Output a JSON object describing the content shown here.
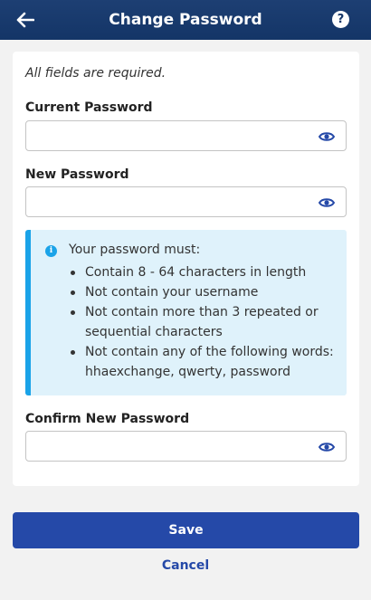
{
  "header": {
    "title": "Change Password",
    "back_icon": "arrow-left-icon",
    "help_label": "?",
    "background_color": "#143567"
  },
  "form": {
    "required_note": "All fields are required.",
    "current_password": {
      "label": "Current Password",
      "value": "",
      "placeholder": ""
    },
    "new_password": {
      "label": "New Password",
      "value": "",
      "placeholder": ""
    },
    "confirm_password": {
      "label": "Confirm New Password",
      "value": "",
      "placeholder": ""
    },
    "visibility_icon": "eye-icon"
  },
  "rules": {
    "icon": "info-icon",
    "icon_glyph": "i",
    "intro": "Your password must:",
    "items": [
      "Contain 8 - 64 characters in length",
      "Not contain your username",
      "Not contain more than 3 repeated or sequential characters",
      "Not contain any of the following words: hhaexchange, qwerty, password"
    ],
    "accent_color": "#1aa3e8",
    "background_color": "#dff2fb"
  },
  "actions": {
    "save_label": "Save",
    "cancel_label": "Cancel",
    "primary_color": "#2549a8"
  }
}
